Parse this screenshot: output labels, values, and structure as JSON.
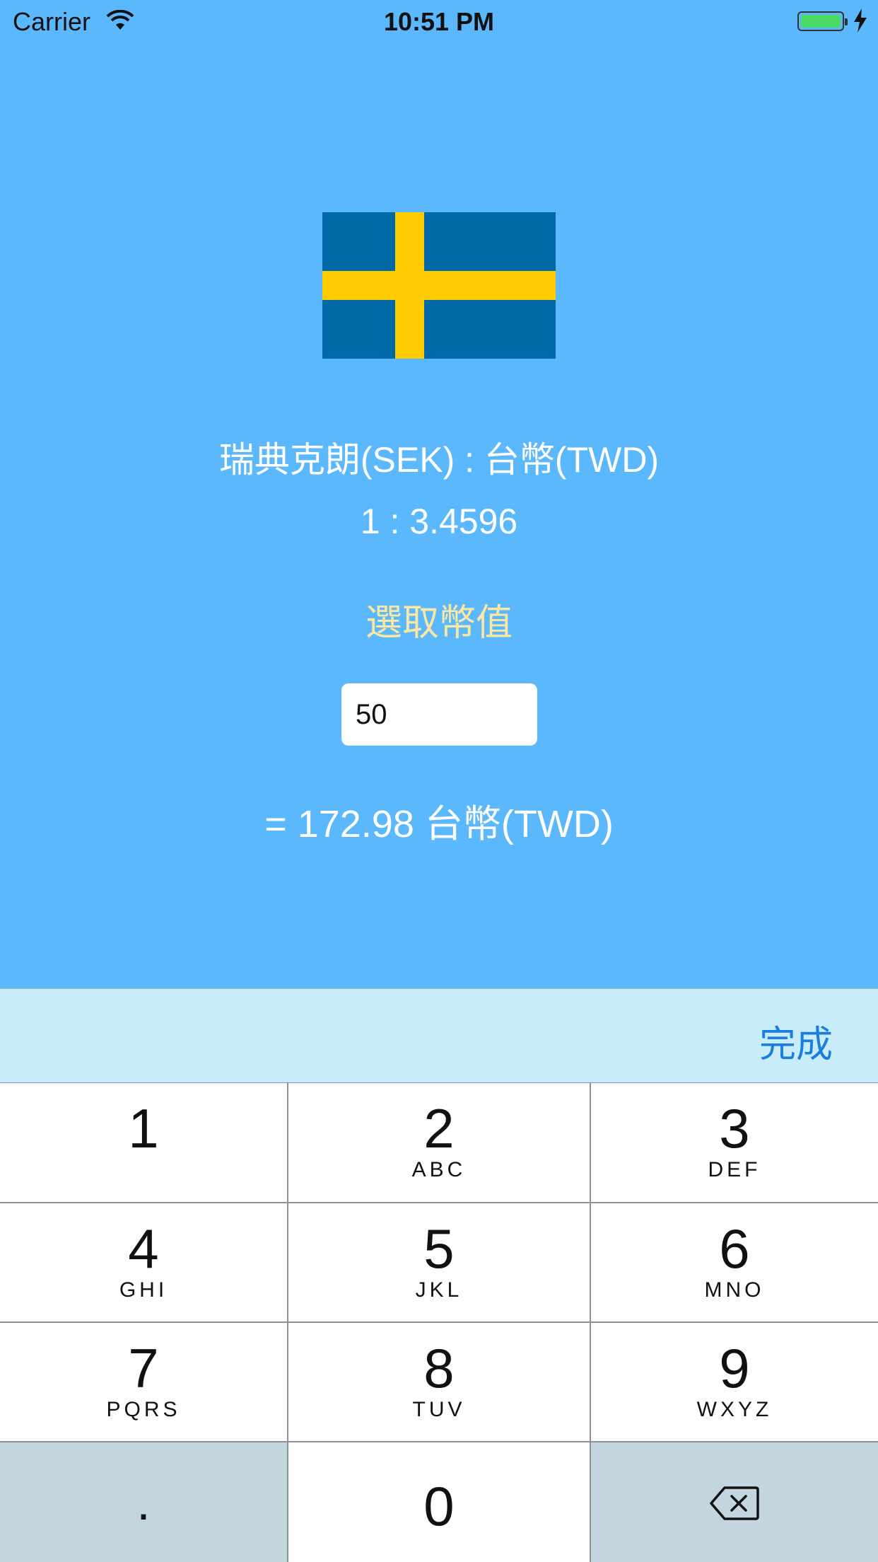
{
  "status_bar": {
    "carrier": "Carrier",
    "time": "10:51 PM"
  },
  "converter": {
    "pair_label": "瑞典克朗(SEK) : 台幣(TWD)",
    "rate_label": "1 : 3.4596",
    "select_label": "選取幣值",
    "amount_value": "50",
    "result_label": "= 172.98 台幣(TWD)"
  },
  "flag": {
    "name": "sweden-flag-icon",
    "colors": {
      "blue": "#006aa7",
      "yellow": "#fecc00"
    }
  },
  "toolbar": {
    "done_label": "完成"
  },
  "keypad": {
    "keys": [
      {
        "digit": "1",
        "letters": ""
      },
      {
        "digit": "2",
        "letters": "ABC"
      },
      {
        "digit": "3",
        "letters": "DEF"
      },
      {
        "digit": "4",
        "letters": "GHI"
      },
      {
        "digit": "5",
        "letters": "JKL"
      },
      {
        "digit": "6",
        "letters": "MNO"
      },
      {
        "digit": "7",
        "letters": "PQRS"
      },
      {
        "digit": "8",
        "letters": "TUV"
      },
      {
        "digit": "9",
        "letters": "WXYZ"
      }
    ],
    "decimal": ".",
    "zero": "0",
    "delete_icon": "delete-backspace-icon"
  },
  "colors": {
    "background": "#5cb8fd",
    "accent_text": "#fbe7a1",
    "toolbar": "#c9ecfa",
    "done": "#1a7ee0"
  }
}
